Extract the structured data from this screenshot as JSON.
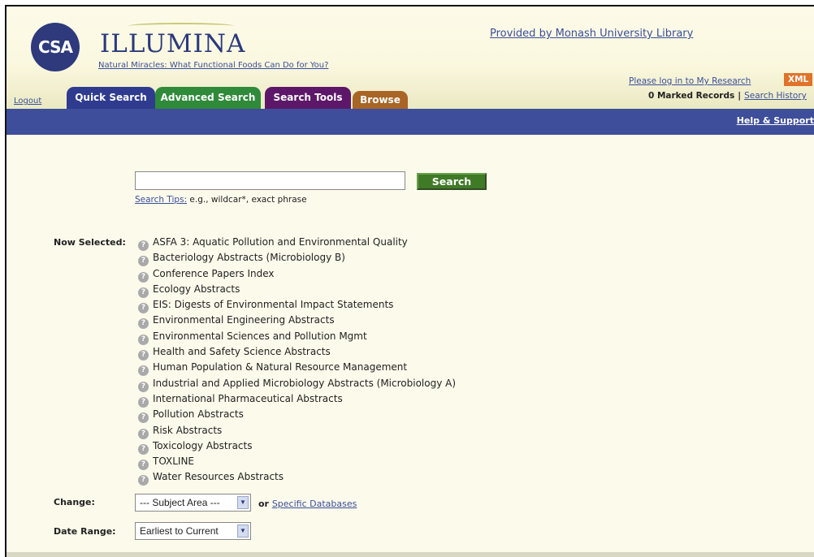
{
  "header": {
    "logo_text": "CSA",
    "brand_name": "ILLUMINA",
    "brand_subtitle": "Natural Miracles: What Functional Foods Can Do for You?",
    "provided_by": "Provided by Monash University Library",
    "login_link": "Please log in to My Research",
    "xml_badge": "XML",
    "marked_records": "0 Marked Records",
    "separator": "|",
    "search_history": "Search History"
  },
  "tabs": {
    "logout": "Logout",
    "quick_search": "Quick Search",
    "advanced_search": "Advanced Search",
    "search_tools": "Search Tools",
    "browse": "Browse"
  },
  "navbar": {
    "help": "Help & Support"
  },
  "search": {
    "value": "",
    "button_label": "Search",
    "tips_link": "Search Tips:",
    "tips_text": " e.g., wildcar*, exact phrase"
  },
  "selection": {
    "label": "Now Selected:",
    "databases": [
      "ASFA 3: Aquatic Pollution and Environmental Quality",
      "Bacteriology Abstracts (Microbiology B)",
      "Conference Papers Index",
      "Ecology Abstracts",
      "EIS: Digests of Environmental Impact Statements",
      "Environmental Engineering Abstracts",
      "Environmental Sciences and Pollution Mgmt",
      "Health and Safety Science Abstracts",
      "Human Population & Natural Resource Management",
      "Industrial and Applied Microbiology Abstracts (Microbiology A)",
      "International Pharmaceutical Abstracts",
      "Pollution Abstracts",
      "Risk Abstracts",
      "Toxicology Abstracts",
      "TOXLINE",
      "Water Resources Abstracts"
    ]
  },
  "change": {
    "label": "Change:",
    "subject_selected": "--- Subject Area ---",
    "or_text": "or ",
    "specific_link": "Specific Databases"
  },
  "date_range": {
    "label": "Date Range:",
    "selected": "Earliest to Current"
  },
  "icons": {
    "info": "question-circle-icon",
    "dropdown": "chevron-down-icon"
  },
  "colors": {
    "navbar": "#3e4e9a",
    "tab_quick": "#2e3b8e",
    "tab_advanced": "#2f8a3a",
    "tab_tools": "#5d1768",
    "tab_browse": "#a86526",
    "search_button": "#3f7a26",
    "xml_badge": "#e0732a"
  }
}
